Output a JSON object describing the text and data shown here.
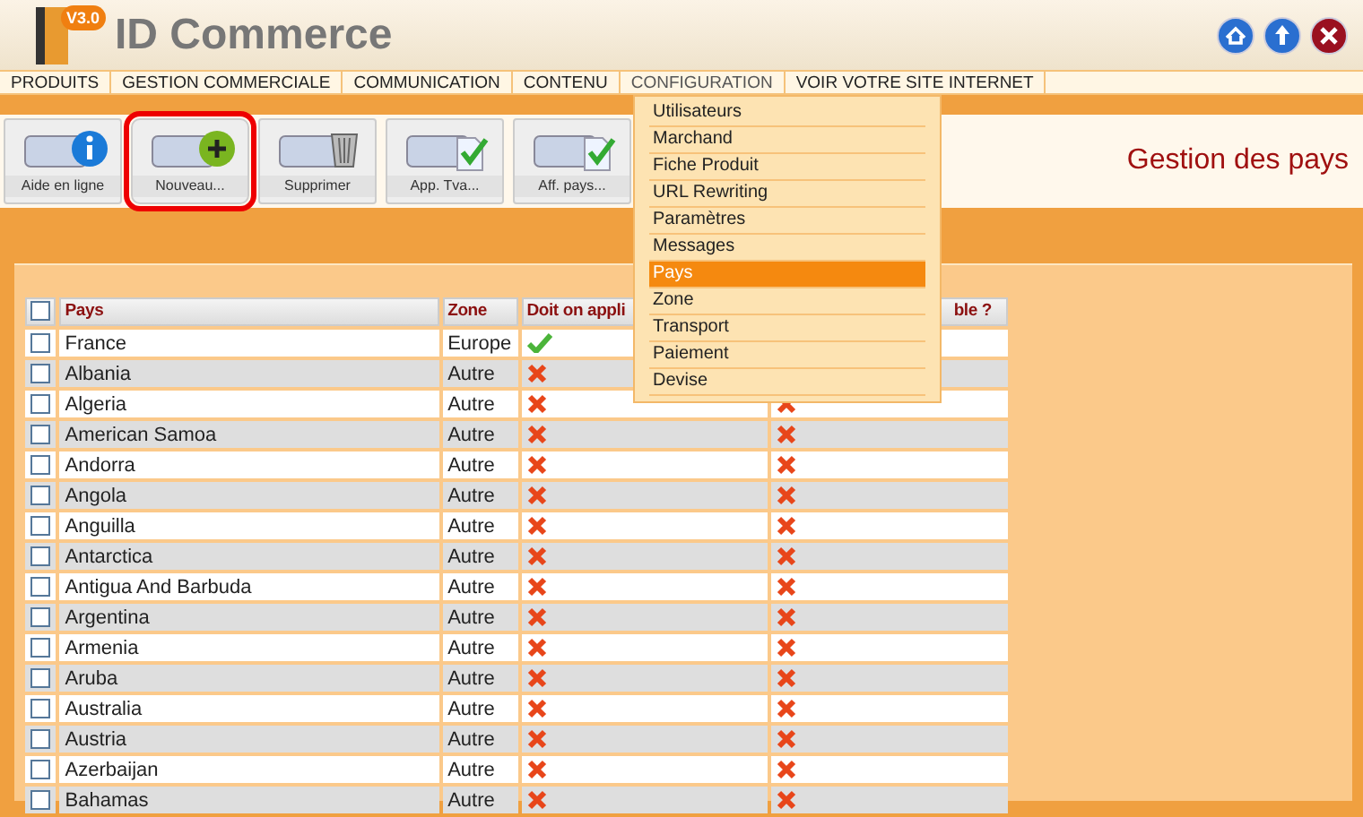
{
  "header": {
    "logo_badge": "V3.0",
    "app_name": "ID Commerce"
  },
  "nav": [
    {
      "label": "PRODUITS",
      "selected": false
    },
    {
      "label": "GESTION COMMERCIALE",
      "selected": false
    },
    {
      "label": "COMMUNICATION",
      "selected": false
    },
    {
      "label": "CONTENU",
      "selected": false
    },
    {
      "label": "CONFIGURATION",
      "selected": true
    },
    {
      "label": "VOIR VOTRE SITE INTERNET",
      "selected": false
    }
  ],
  "dropdown": [
    {
      "label": "Utilisateurs",
      "selected": false
    },
    {
      "label": "Marchand",
      "selected": false
    },
    {
      "label": "Fiche Produit",
      "selected": false
    },
    {
      "label": "URL Rewriting",
      "selected": false
    },
    {
      "label": "Paramètres",
      "selected": false
    },
    {
      "label": "Messages",
      "selected": false
    },
    {
      "label": "Pays",
      "selected": true
    },
    {
      "label": "Zone",
      "selected": false
    },
    {
      "label": "Transport",
      "selected": false
    },
    {
      "label": "Paiement",
      "selected": false
    },
    {
      "label": "Devise",
      "selected": false
    }
  ],
  "toolbar": [
    {
      "label": "Aide en ligne",
      "kind": "info",
      "highlighted": false
    },
    {
      "label": "Nouveau...",
      "kind": "add",
      "highlighted": true
    },
    {
      "label": "Supprimer",
      "kind": "trash",
      "highlighted": false
    },
    {
      "label": "App. Tva...",
      "kind": "check",
      "highlighted": false
    },
    {
      "label": "Aff. pays...",
      "kind": "check",
      "highlighted": false
    }
  ],
  "page_title": "Gestion des pays",
  "table": {
    "select_all_checked": false,
    "columns": [
      "Pays",
      "Zone",
      "Doit on appli",
      "ble ?"
    ],
    "rows": [
      {
        "checked": false,
        "pays": "France",
        "zone": "Europe",
        "col3_ok": true
      },
      {
        "checked": false,
        "pays": "Albania",
        "zone": "Autre",
        "col3_ok": false
      },
      {
        "checked": false,
        "pays": "Algeria",
        "zone": "Autre",
        "col3_ok": false,
        "col4_ok": false
      },
      {
        "checked": false,
        "pays": "American Samoa",
        "zone": "Autre",
        "col3_ok": false,
        "col4_ok": false
      },
      {
        "checked": false,
        "pays": "Andorra",
        "zone": "Autre",
        "col3_ok": false,
        "col4_ok": false
      },
      {
        "checked": false,
        "pays": "Angola",
        "zone": "Autre",
        "col3_ok": false,
        "col4_ok": false
      },
      {
        "checked": false,
        "pays": "Anguilla",
        "zone": "Autre",
        "col3_ok": false,
        "col4_ok": false
      },
      {
        "checked": false,
        "pays": "Antarctica",
        "zone": "Autre",
        "col3_ok": false,
        "col4_ok": false
      },
      {
        "checked": false,
        "pays": "Antigua And Barbuda",
        "zone": "Autre",
        "col3_ok": false,
        "col4_ok": false
      },
      {
        "checked": false,
        "pays": "Argentina",
        "zone": "Autre",
        "col3_ok": false,
        "col4_ok": false
      },
      {
        "checked": false,
        "pays": "Armenia",
        "zone": "Autre",
        "col3_ok": false,
        "col4_ok": false
      },
      {
        "checked": false,
        "pays": "Aruba",
        "zone": "Autre",
        "col3_ok": false,
        "col4_ok": false
      },
      {
        "checked": false,
        "pays": "Australia",
        "zone": "Autre",
        "col3_ok": false,
        "col4_ok": false
      },
      {
        "checked": false,
        "pays": "Austria",
        "zone": "Autre",
        "col3_ok": false,
        "col4_ok": false
      },
      {
        "checked": false,
        "pays": "Azerbaijan",
        "zone": "Autre",
        "col3_ok": false,
        "col4_ok": false
      },
      {
        "checked": false,
        "pays": "Bahamas",
        "zone": "Autre",
        "col3_ok": false,
        "col4_ok": false
      }
    ]
  }
}
